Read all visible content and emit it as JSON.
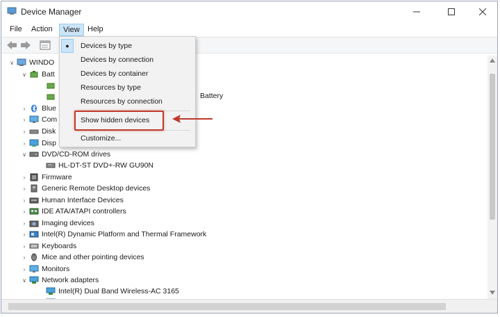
{
  "window": {
    "title": "Device Manager"
  },
  "menu": {
    "file": "File",
    "action": "Action",
    "view": "View",
    "help": "Help"
  },
  "tree": {
    "root": "WINDO",
    "battery_truncated": "Batt",
    "battery_suffix": "Battery",
    "bluetooth": "Blue",
    "computer": "Com",
    "disk": "Disk",
    "display": "Disp",
    "dvd": "DVD/CD-ROM drives",
    "dvd_child": "HL-DT-ST DVD+-RW GU90N",
    "firmware": "Firmware",
    "generic_remote": "Generic Remote Desktop devices",
    "hid": "Human Interface Devices",
    "ide": "IDE ATA/ATAPI controllers",
    "imaging": "Imaging devices",
    "intel_platform": "Intel(R) Dynamic Platform and Thermal Framework",
    "keyboards": "Keyboards",
    "mice": "Mice and other pointing devices",
    "monitors": "Monitors",
    "network": "Network adapters",
    "network_child": "Intel(R) Dual Band Wireless-AC 3165"
  },
  "view_menu": {
    "devices_by_type": "Devices by type",
    "devices_by_connection": "Devices by connection",
    "devices_by_container": "Devices by container",
    "resources_by_type": "Resources by type",
    "resources_by_connection": "Resources by connection",
    "show_hidden": "Show hidden devices",
    "customize": "Customize..."
  },
  "colors": {
    "highlight": "#c0392b",
    "menu_active": "#cce4f7"
  }
}
